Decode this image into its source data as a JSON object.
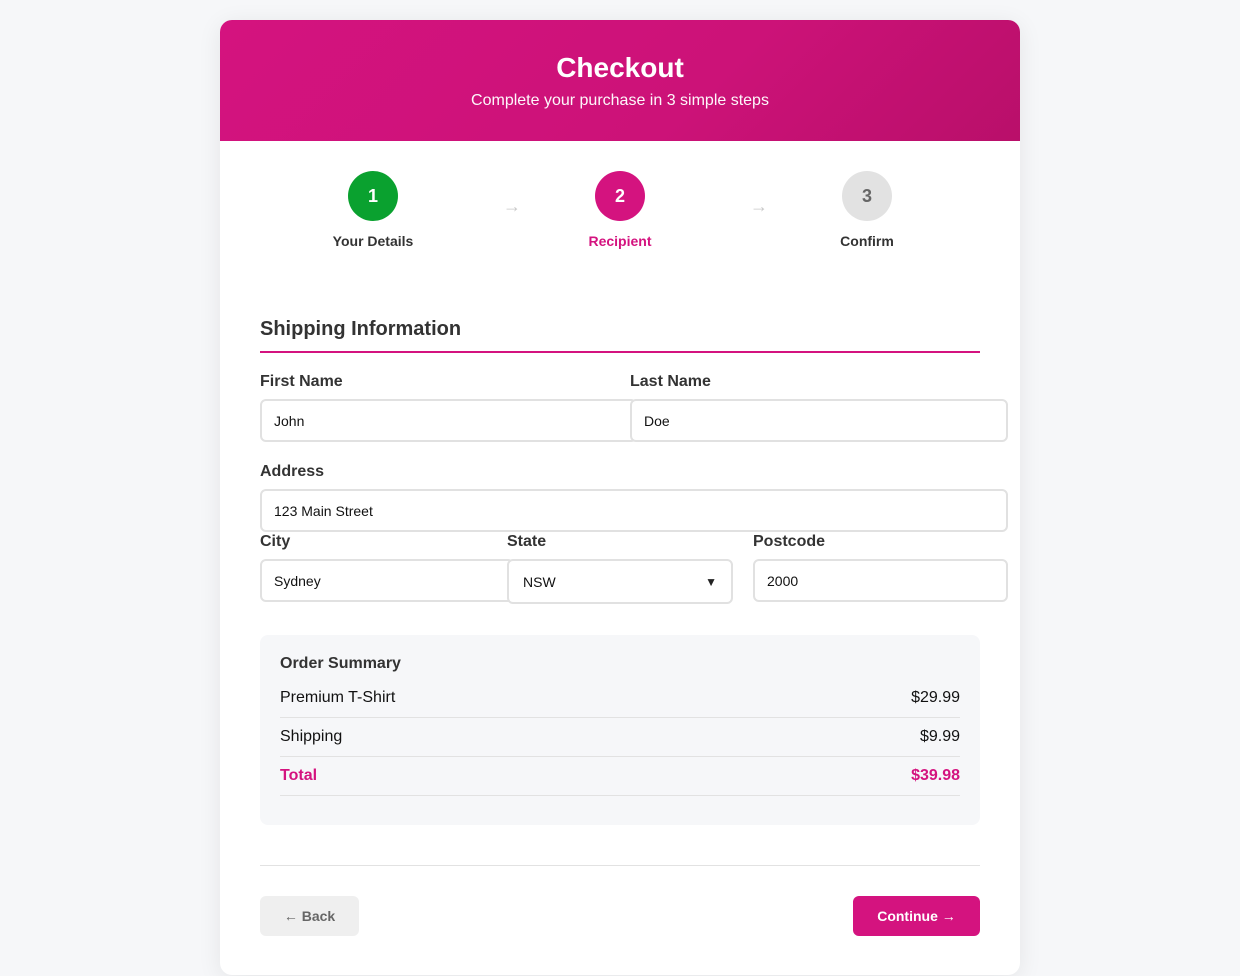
{
  "header": {
    "title": "Checkout",
    "subtitle": "Complete your purchase in 3 simple steps"
  },
  "steps": [
    {
      "number": "1",
      "label": "Your Details",
      "status": "completed"
    },
    {
      "number": "2",
      "label": "Recipient",
      "status": "active"
    },
    {
      "number": "3",
      "label": "Confirm",
      "status": "pending"
    }
  ],
  "step_arrow": "→",
  "section": {
    "title": "Shipping Information"
  },
  "form": {
    "first_name": {
      "label": "First Name",
      "value": "John"
    },
    "last_name": {
      "label": "Last Name",
      "value": "Doe"
    },
    "address": {
      "label": "Address",
      "value": "123 Main Street"
    },
    "city": {
      "label": "City",
      "value": "Sydney"
    },
    "state": {
      "label": "State",
      "value": "NSW"
    },
    "postcode": {
      "label": "Postcode",
      "value": "2000"
    }
  },
  "summary": {
    "title": "Order Summary",
    "rows": [
      {
        "label": "Premium T-Shirt",
        "amount": "$29.99"
      },
      {
        "label": "Shipping",
        "amount": "$9.99"
      },
      {
        "label": "Total",
        "amount": "$39.98"
      }
    ]
  },
  "actions": {
    "back_label": "← Back",
    "continue_label": "Continue →"
  },
  "colors": {
    "accent": "#d4137f",
    "success": "#0aa12f",
    "pending": "#e2e2e2"
  }
}
